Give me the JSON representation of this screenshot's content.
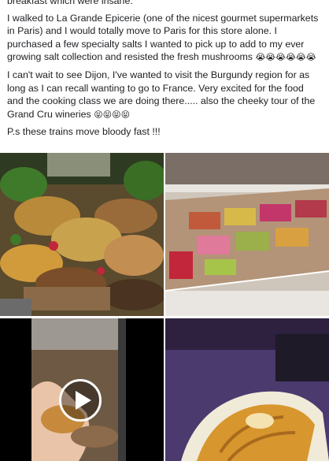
{
  "post": {
    "paragraphs": [
      {
        "text": "breakfast which were insane."
      },
      {
        "text": "I walked to La Grande Epicerie (one of the nicest gourmet supermarkets in Paris) and I would totally move to Paris for this store alone. I purchased a few specialty salts I wanted to pick up to add to my ever growing salt collection and resisted the fresh mushrooms ",
        "emoji": "😭😭😭😭😭😭"
      },
      {
        "text": "I can't wait to see Dijon, I've wanted to visit the Burgundy region for as long as I can recall wanting to go to France. Very excited for the food and the cooking class we are doing there..... also the cheeky tour of the Grand Cru wineries ",
        "emoji": "😝😝😝😝"
      },
      {
        "text": "P.s these trains move bloody fast !!!"
      }
    ]
  },
  "photos": [
    {
      "name": "mushroom-market-photo"
    },
    {
      "name": "macaron-display-photo"
    },
    {
      "name": "pastry-video-thumbnail",
      "video": true
    },
    {
      "name": "croissant-photo"
    }
  ],
  "colors": {
    "text": "#1c1e21",
    "background": "#ffffff"
  }
}
